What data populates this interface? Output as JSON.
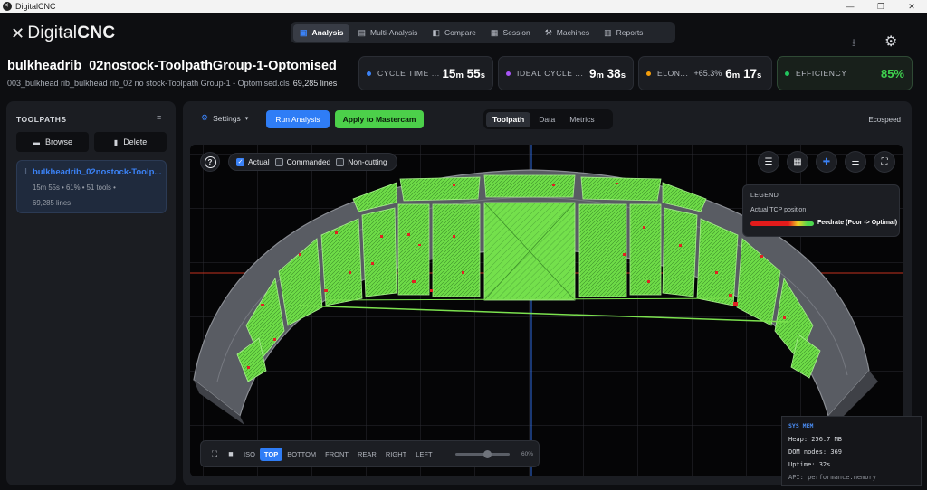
{
  "window": {
    "title": "DigitalCNC",
    "controls": [
      "—",
      "❐",
      "✕"
    ]
  },
  "app": {
    "logo_light": "Digital",
    "logo_bold": "CNC"
  },
  "nav": {
    "tabs": [
      {
        "label": "Analysis",
        "icon": "chart-icon",
        "glyph": "▣",
        "active": true
      },
      {
        "label": "Multi-Analysis",
        "icon": "layers-icon",
        "glyph": "▤"
      },
      {
        "label": "Compare",
        "icon": "compare-icon",
        "glyph": "◧"
      },
      {
        "label": "Session",
        "icon": "session-icon",
        "glyph": "▦"
      },
      {
        "label": "Machines",
        "icon": "machine-icon",
        "glyph": "⚒"
      },
      {
        "label": "Reports",
        "icon": "report-icon",
        "glyph": "▥"
      }
    ],
    "download_glyph": "⭳",
    "settings_glyph": "⚙"
  },
  "header": {
    "title": "bulkheadrib_02nostock-ToolpathGroup-1-Optomised",
    "subtitle": "003_bulkhead rib_bulkhead rib_02 no stock-Toolpath Group-1 - Optomised.cls",
    "line_count": "69,285 lines"
  },
  "metrics": {
    "cycle_time": {
      "label": "CYCLE TIME ...",
      "min": "15",
      "sec": "55",
      "color": "#3b82f6"
    },
    "ideal_cycle": {
      "label": "IDEAL CYCLE ...",
      "min": "9",
      "sec": "38",
      "color": "#a855f7"
    },
    "elongation": {
      "label": "ELON...",
      "pct": "+65.3%",
      "min": "6",
      "sec": "17",
      "color": "#f59e0b"
    },
    "efficiency": {
      "label": "EFFICIENCY",
      "value": "85%",
      "color": "#22c55e"
    },
    "unit_min": "m",
    "unit_sec": "s"
  },
  "sidebar": {
    "title": "TOOLPATHS",
    "sort_glyph": "≡",
    "browse_label": "Browse",
    "delete_label": "Delete",
    "item": {
      "name": "bulkheadrib_02nostock-Toolp...",
      "meta": "15m 55s  •  61%  •  51 tools  •",
      "lines": "69,285 lines"
    }
  },
  "toolbar": {
    "settings_label": "Settings",
    "run_label": "Run Analysis",
    "apply_label": "Apply to Mastercam",
    "view_tabs": [
      {
        "label": "Toolpath",
        "active": true
      },
      {
        "label": "Data"
      },
      {
        "label": "Metrics"
      }
    ],
    "machine": "Ecospeed"
  },
  "viewport": {
    "filters": [
      {
        "label": "Actual",
        "checked": true
      },
      {
        "label": "Commanded",
        "checked": false
      },
      {
        "label": "Non-cutting",
        "checked": false
      }
    ],
    "tool_icons": [
      "list-icon",
      "grid-icon",
      "puzzle-icon",
      "sliders-icon",
      "fullscreen-icon"
    ],
    "legend": {
      "title": "LEGEND",
      "subtitle": "Actual TCP position",
      "gradient_label": "Feedrate (Poor -> Optimal)",
      "colors": [
        "#e31b1b",
        "#f2d024",
        "#4ed84e"
      ]
    },
    "views": [
      "ISO",
      "TOP",
      "BOTTOM",
      "FRONT",
      "REAR",
      "RIGHT",
      "LEFT"
    ],
    "active_view": "TOP",
    "zoom": "60%",
    "zoom_fraction": 0.6
  },
  "sysmem": {
    "title": "SYS MEM",
    "heap": "Heap: 256.7 MB",
    "dom": "DOM nodes: 369",
    "uptime": "Uptime: 32s",
    "api": "API: performance.memory"
  }
}
